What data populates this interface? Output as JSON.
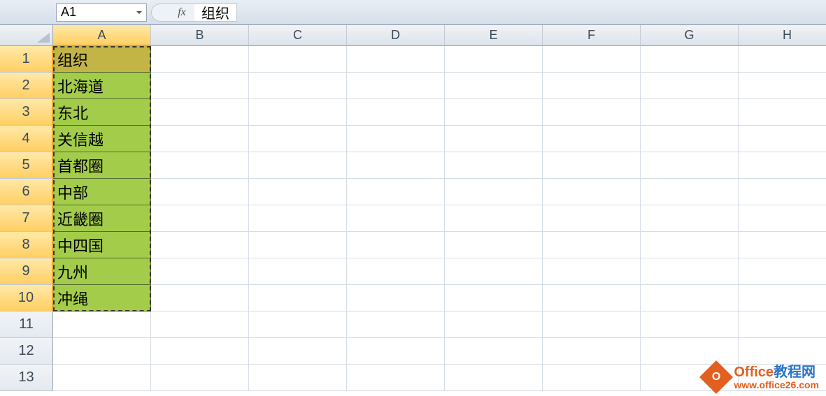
{
  "name_box": "A1",
  "fx_label": "fx",
  "formula_value": "组织",
  "columns": [
    "A",
    "B",
    "C",
    "D",
    "E",
    "F",
    "G",
    "H"
  ],
  "selected_col_index": 0,
  "rows": [
    "1",
    "2",
    "3",
    "4",
    "5",
    "6",
    "7",
    "8",
    "9",
    "10",
    "11",
    "12",
    "13"
  ],
  "selected_row_start": 0,
  "selected_row_end": 9,
  "colA": {
    "header": "组织",
    "data": [
      "北海道",
      "东北",
      "关信越",
      "首都圈",
      "中部",
      "近畿圈",
      "中四国",
      "九州",
      "冲绳"
    ]
  },
  "watermark": {
    "icon_text": "O",
    "line1_part1": "Office",
    "line1_part2": "教程网",
    "line2": "www.office26.com"
  }
}
